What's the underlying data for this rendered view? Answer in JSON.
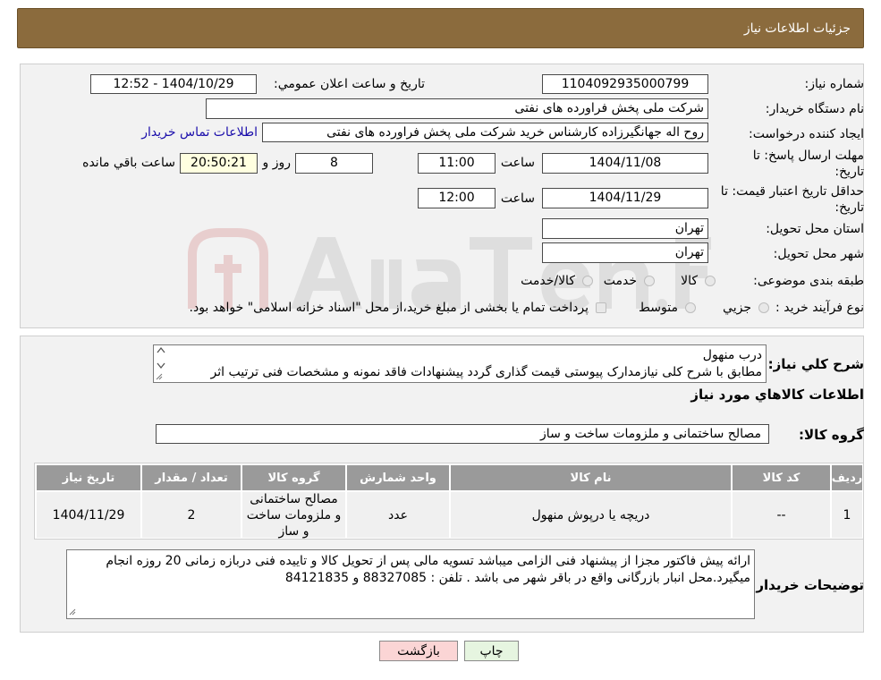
{
  "header": {
    "title": "جزئیات اطلاعات نیاز"
  },
  "details": {
    "need_number_label": "شماره نیاز:",
    "need_number": "1104092935000799",
    "announce_label": "تاریخ و ساعت اعلان عمومي:",
    "announce_value": "1404/10/29 - 12:52",
    "buyer_org_label": "نام دستگاه خريدار:",
    "buyer_org": "شرکت ملی پخش فراورده های نفتی",
    "creator_label": "ايجاد کننده درخواست:",
    "creator": "روح اله جهانگیرزاده کارشناس خرید شرکت ملی پخش فراورده های نفتی",
    "contact_link": "اطلاعات تماس خريدار",
    "deadline_label_1": "مهلت ارسال پاسخ: تا",
    "deadline_label_2": "تاريخ:",
    "deadline_date": "1404/11/08",
    "time_label": "ساعت",
    "deadline_time": "11:00",
    "days_value": "8",
    "days_label": "روز و",
    "remaining_time": "20:50:21",
    "remaining_label": "ساعت باقي مانده",
    "validity_label_1": "حداقل تاريخ اعتبار قيمت: تا",
    "validity_label_2": "تاريخ:",
    "validity_date": "1404/11/29",
    "validity_time": "12:00",
    "province_label": "استان محل تحويل:",
    "province": "تهران",
    "city_label": "شهر محل تحويل:",
    "city": "تهران",
    "category_label": "طبقه بندی موضوعی:",
    "category_options": [
      "کالا",
      "خدمت",
      "کالا/خدمت"
    ],
    "purchase_type_label": "نوع فرآيند خريد :",
    "purchase_options": [
      "جزيي",
      "متوسط"
    ],
    "purchase_note": "پرداخت تمام يا بخشی از مبلغ خريد،از محل \"اسناد خزانه اسلامی\" خواهد بود."
  },
  "summary": {
    "general_desc_label": "شرح کلي نياز:",
    "general_desc_line1": "درب منهول",
    "general_desc_line2": "مطابق با شرح کلی نیازمدارک پیوستی قیمت گذاری گردد پیشنهادات فاقد نمونه و مشخصات فنی ترتیب اثر",
    "items_section_title": "اطلاعات کالاهاي مورد نياز",
    "goods_group_label": "گروه کالا:",
    "goods_group": "مصالح ساختمانی و ملزومات ساخت و ساز"
  },
  "table": {
    "headers": [
      "رديف",
      "کد کالا",
      "نام کالا",
      "واحد شمارش",
      "گروه کالا",
      "تعداد / مقدار",
      "تاريخ نياز"
    ],
    "rows": [
      [
        "1",
        "--",
        "دریچه یا درپوش منهول",
        "عدد",
        "مصالح ساختمانی و ملزومات ساخت و ساز",
        "2",
        "1404/11/29"
      ]
    ]
  },
  "buyer_notes": {
    "label": "توضيحات خريدار:",
    "line1": "ارائه پیش فاکتور مجزا از پیشنهاد فنی الزامی میباشد تسویه مالی پس از تحویل کالا و تاییده فنی دربازه زمانی 20 روزه انجام",
    "line2": "میگیرد.محل انبار بازرگانی واقع در باقر شهر می باشد . تلفن : 88327085 و 84121835"
  },
  "buttons": {
    "print": "چاپ",
    "back": "بازگشت"
  },
  "colors": {
    "header_bg": "#8b6b3d",
    "back_btn_bg": "#fbd5d5",
    "print_btn_bg": "#e6f5e0"
  }
}
